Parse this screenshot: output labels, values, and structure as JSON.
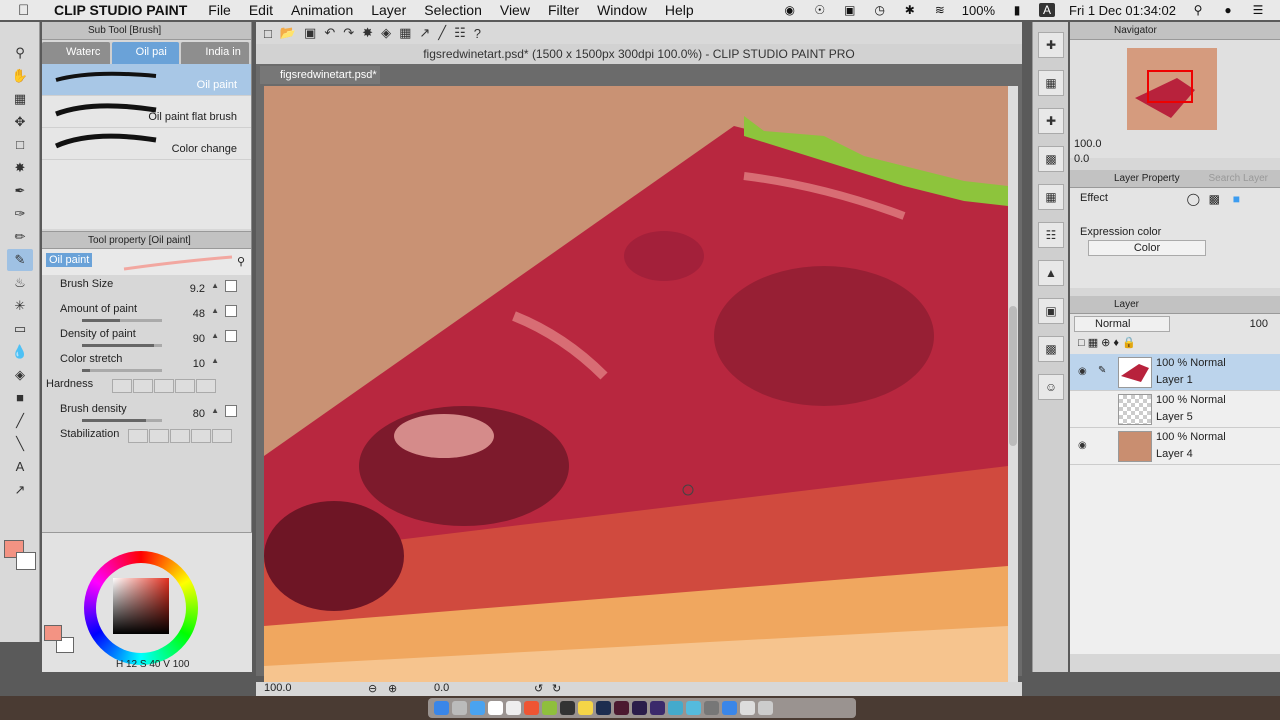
{
  "menubar": {
    "app_name": "CLIP STUDIO PAINT",
    "items": [
      "File",
      "Edit",
      "Animation",
      "Layer",
      "Selection",
      "View",
      "Filter",
      "Window",
      "Help"
    ],
    "battery": "100%",
    "datetime": "Fri 1 Dec  01:34:02"
  },
  "subtool": {
    "title": "Sub Tool [Brush]",
    "tabs": [
      "Waterc",
      "Oil pai",
      "India in"
    ],
    "brushes": [
      "Oil paint",
      "Oil paint flat brush",
      "Color change"
    ]
  },
  "toolprop": {
    "title": "Tool property [Oil paint]",
    "preview_name": "Oil paint",
    "props": [
      {
        "name": "Brush Size",
        "value": "9.2"
      },
      {
        "name": "Amount of paint",
        "value": "48"
      },
      {
        "name": "Density of paint",
        "value": "90"
      },
      {
        "name": "Color stretch",
        "value": "10"
      },
      {
        "name": "Hardness",
        "value": ""
      },
      {
        "name": "Brush density",
        "value": "80"
      },
      {
        "name": "Stabilization",
        "value": ""
      }
    ]
  },
  "color": {
    "main_hex": "#f39383",
    "hsv_text": "H  12 S  40 V  100"
  },
  "canvas": {
    "window_title": "figsredwinetart.psd* (1500 x 1500px 300dpi 100.0%)  - CLIP STUDIO PAINT PRO",
    "doc_tab": "figsredwinetart.psd*",
    "zoom": "100.0",
    "angle": "0.0"
  },
  "navigator": {
    "title": "Navigator",
    "zoom": "100.0",
    "angle": "0.0"
  },
  "layerprop": {
    "title": "Layer Property",
    "search": "Search Layer",
    "effect": "Effect",
    "expression_color_label": "Expression color",
    "expression_color_value": "Color"
  },
  "layerpanel": {
    "title": "Layer",
    "blend": "Normal",
    "opacity": "100",
    "layers": [
      {
        "mode": "100 % Normal",
        "name": "Layer 1"
      },
      {
        "mode": "100 % Normal",
        "name": "Layer 5"
      },
      {
        "mode": "100 % Normal",
        "name": "Layer 4"
      }
    ]
  }
}
